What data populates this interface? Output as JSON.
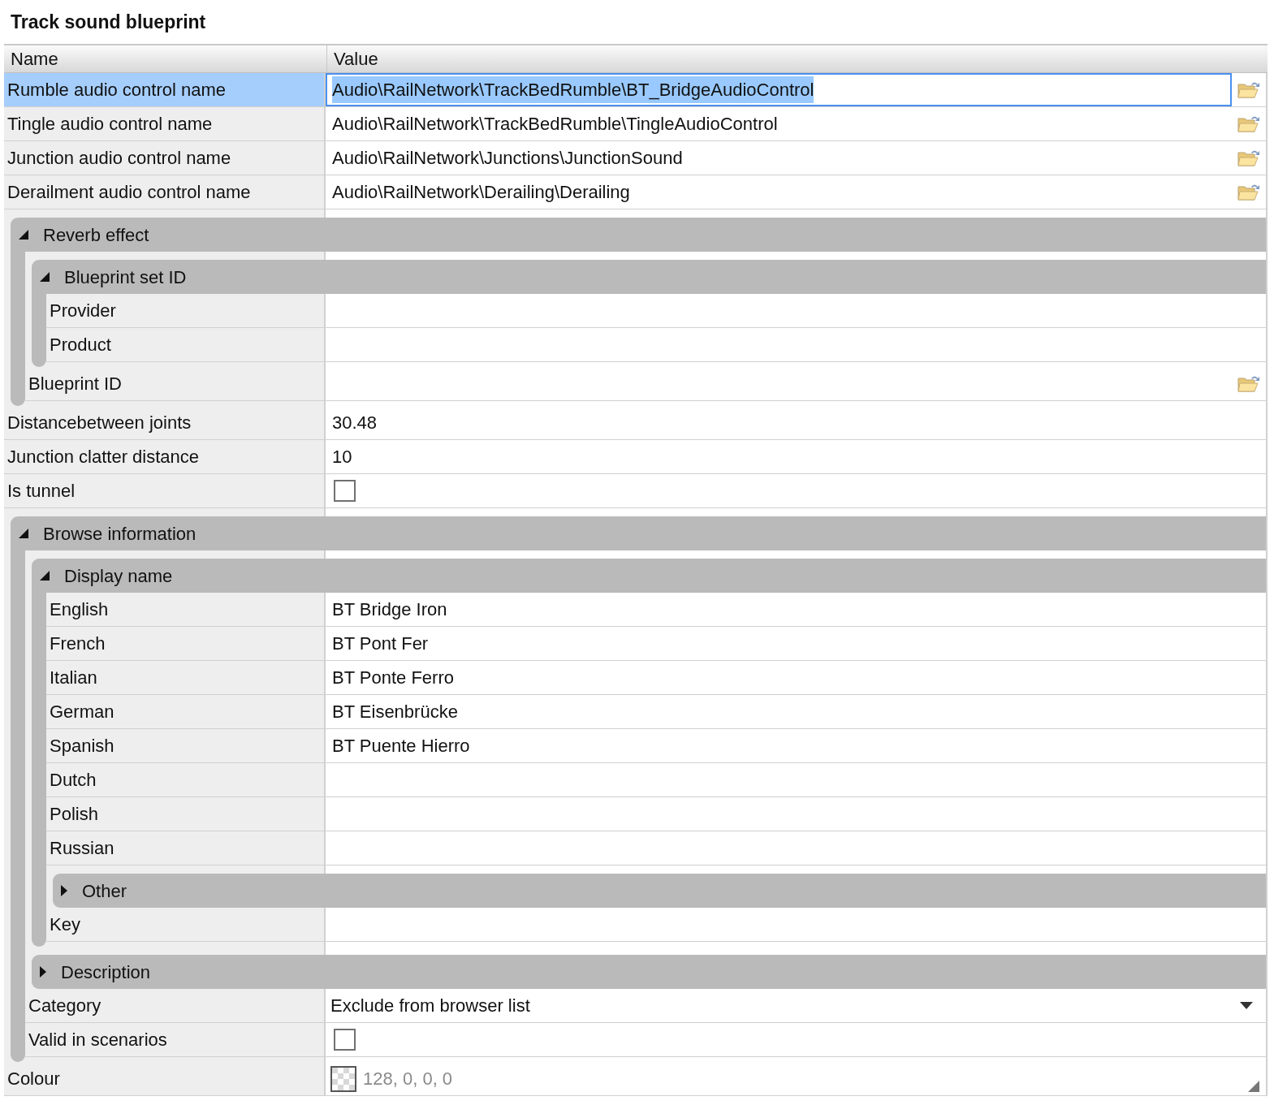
{
  "title": "Track sound blueprint",
  "columns": [
    "Name",
    "Value"
  ],
  "items": [
    {
      "kind": "path",
      "label": "Rumble audio control name",
      "value": "Audio\\RailNetwork\\TrackBedRumble\\BT_BridgeAudioControl",
      "selected": true
    },
    {
      "kind": "path",
      "label": "Tingle audio control name",
      "value": "Audio\\RailNetwork\\TrackBedRumble\\TingleAudioControl",
      "selected": false
    },
    {
      "kind": "path",
      "label": "Junction audio control name",
      "value": "Audio\\RailNetwork\\Junctions\\JunctionSound",
      "selected": false
    },
    {
      "kind": "path",
      "label": "Derailment audio control name",
      "value": "Audio\\RailNetwork\\Derailing\\Derailing",
      "selected": false
    },
    {
      "kind": "group",
      "label": "Reverb effect",
      "expanded": true,
      "selected": false,
      "children": [
        {
          "kind": "group",
          "label": "Blueprint set ID",
          "expanded": true,
          "selected": false,
          "children": [
            {
              "kind": "text",
              "label": "Provider",
              "selected": false
            },
            {
              "kind": "text",
              "label": "Product",
              "selected": false
            }
          ]
        },
        {
          "kind": "path",
          "label": "Blueprint ID",
          "selected": false
        }
      ]
    },
    {
      "kind": "text",
      "label": "Distancebetween joints",
      "value": "30.48",
      "selected": false
    },
    {
      "kind": "text",
      "label": "Junction clatter distance",
      "value": "10",
      "selected": false
    },
    {
      "kind": "checkbox",
      "label": "Is tunnel",
      "checked": false,
      "selected": false
    },
    {
      "kind": "group",
      "label": "Browse information",
      "expanded": true,
      "selected": false,
      "children": [
        {
          "kind": "group",
          "label": "Display name",
          "expanded": true,
          "selected": false,
          "children": [
            {
              "kind": "text",
              "label": "English",
              "value": "BT Bridge Iron",
              "selected": false
            },
            {
              "kind": "text",
              "label": "French",
              "value": "BT Pont Fer",
              "selected": false
            },
            {
              "kind": "text",
              "label": "Italian",
              "value": "BT Ponte Ferro",
              "selected": false
            },
            {
              "kind": "text",
              "label": "German",
              "value": "BT Eisenbrücke",
              "selected": false
            },
            {
              "kind": "text",
              "label": "Spanish",
              "value": "BT Puente Hierro",
              "selected": false
            },
            {
              "kind": "text",
              "label": "Dutch",
              "selected": false
            },
            {
              "kind": "text",
              "label": "Polish",
              "selected": false
            },
            {
              "kind": "text",
              "label": "Russian",
              "selected": false
            },
            {
              "kind": "group",
              "label": "Other",
              "expanded": false,
              "selected": false
            },
            {
              "kind": "text",
              "label": "Key",
              "selected": false
            }
          ]
        },
        {
          "kind": "group",
          "label": "Description",
          "expanded": false,
          "selected": false
        },
        {
          "kind": "dropdown",
          "label": "Category",
          "value": "Exclude from browser list",
          "selected": false
        },
        {
          "kind": "checkbox",
          "label": "Valid in scenarios",
          "checked": false,
          "selected": false
        }
      ]
    },
    {
      "kind": "colour",
      "label": "Colour",
      "value": "128, 0, 0, 0",
      "selected": false
    }
  ]
}
